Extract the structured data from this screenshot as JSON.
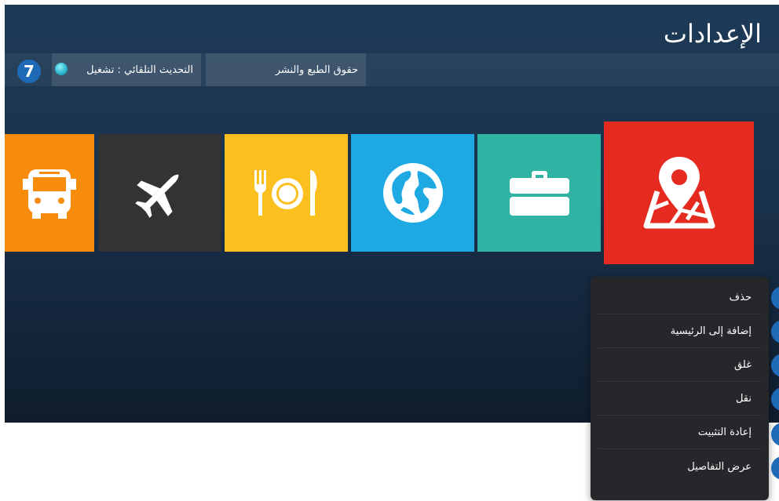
{
  "header": {
    "title": "الإعدادات"
  },
  "topbar": {
    "copyright_label": "حقوق الطبع والنشر",
    "auto_update_label": "التحديث التلقائي : تشغيل",
    "badge_number": "7"
  },
  "tiles": [
    {
      "icon": "bus-icon",
      "color": "#f78b0c"
    },
    {
      "icon": "airplane-icon",
      "color": "#333333"
    },
    {
      "icon": "dining-icon",
      "color": "#fbbf20"
    },
    {
      "icon": "globe-icon",
      "color": "#1ea9e3"
    },
    {
      "icon": "briefcase-icon",
      "color": "#2fb3a2"
    },
    {
      "icon": "map-pin-icon",
      "color": "#e52a1f",
      "focused": true
    }
  ],
  "context_menu": {
    "items": [
      {
        "label": "حذف"
      },
      {
        "label": "إضافة إلى الرئيسية"
      },
      {
        "label": "غلق"
      },
      {
        "label": "نقل"
      },
      {
        "label": "إعادة التثبيت"
      },
      {
        "label": "عرض التفاصيل"
      }
    ]
  },
  "colors": {
    "accent": "#1f6ab7",
    "background": "#1d3a57",
    "menu": "#26272a"
  }
}
